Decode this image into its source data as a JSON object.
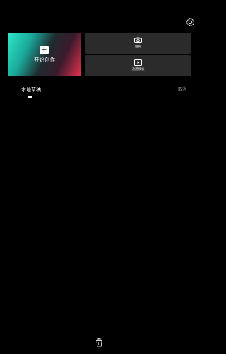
{
  "header": {
    "settings_icon": "gear-icon"
  },
  "actions": {
    "create": {
      "label": "开始创作",
      "icon": "plus-icon",
      "plus_glyph": "+"
    },
    "shoot": {
      "label": "拍摄",
      "icon": "camera-icon"
    },
    "template": {
      "label": "通用模板",
      "icon": "template-icon"
    }
  },
  "drafts": {
    "title": "本地草稿",
    "cancel_label": "取消"
  },
  "footer": {
    "delete_icon": "trash-icon"
  },
  "colors": {
    "background": "#000000",
    "button_bg": "#2b2b2b",
    "gradient_start": "#2ee8c8",
    "gradient_end": "#e8324f",
    "muted_text": "#9a9a9a"
  }
}
